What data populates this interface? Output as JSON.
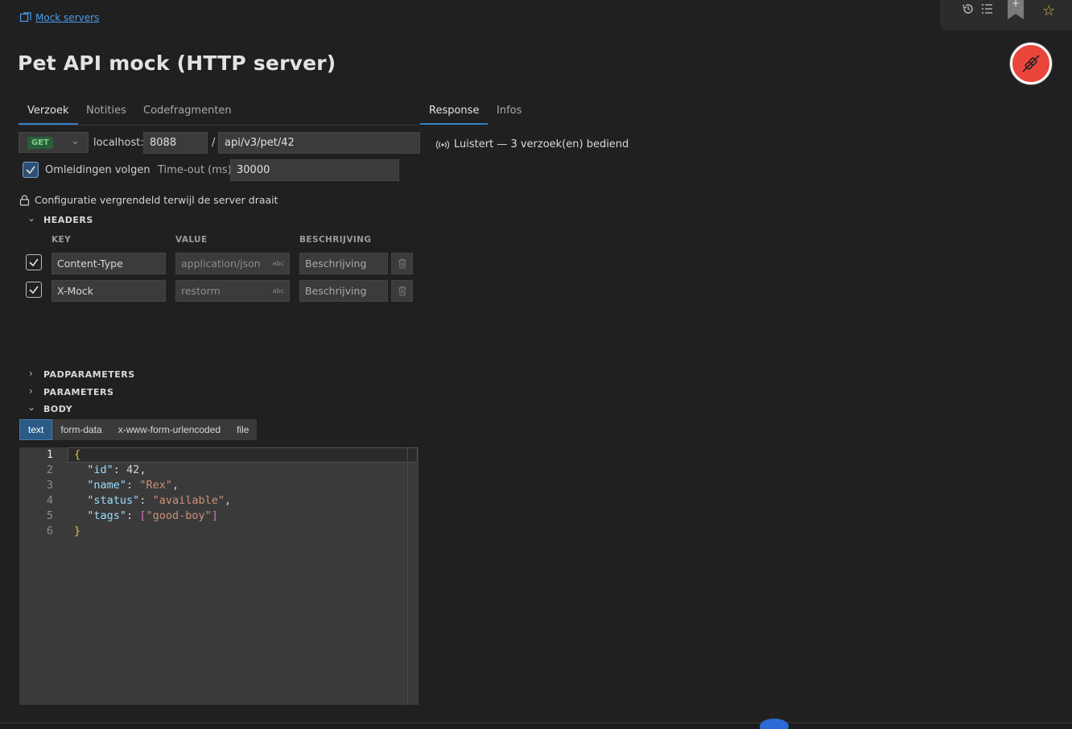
{
  "breadcrumb": {
    "label": "Mock servers"
  },
  "title": "Pet API mock (HTTP server)",
  "toolbar": {
    "icons": [
      "history-icon",
      "list-icon",
      "bookmark-add-icon",
      "star-icon"
    ],
    "star_color": "#e2b74a"
  },
  "status_badge": {
    "color": "#e9453a",
    "icon": "plug-disconnect-icon"
  },
  "left_tabs": [
    {
      "label": "Verzoek",
      "active": true
    },
    {
      "label": "Notities",
      "active": false
    },
    {
      "label": "Codefragmenten",
      "active": false
    }
  ],
  "right_tabs": [
    {
      "label": "Response",
      "active": true
    },
    {
      "label": "Infos",
      "active": false
    }
  ],
  "request": {
    "method": "GET",
    "host_label": "localhost:",
    "port": "8088",
    "separator": "/",
    "path": "api/v3/pet/42"
  },
  "options": {
    "follow_redirects_label": "Omleidingen volgen",
    "follow_redirects": true,
    "timeout_label": "Time-out (ms)",
    "timeout_value": "30000"
  },
  "lock_notice": "Configuratie vergrendeld terwijl de server draait",
  "headers": {
    "section_label": "HEADERS",
    "columns": {
      "key": "KEY",
      "value": "VALUE",
      "description": "BESCHRIJVING"
    },
    "rows": [
      {
        "enabled": true,
        "key": "Content-Type",
        "value": "application/json",
        "value_type": "abc",
        "description": "Beschrijving"
      },
      {
        "enabled": true,
        "key": "X-Mock",
        "value": "restorm",
        "value_type": "abc",
        "description": "Beschrijving"
      }
    ]
  },
  "sections": {
    "path_params": "PADPARAMETERS",
    "params": "PARAMETERS",
    "body": "BODY"
  },
  "body_tabs": [
    {
      "label": "text",
      "active": true
    },
    {
      "label": "form-data",
      "active": false
    },
    {
      "label": "x-www-form-urlencoded",
      "active": false
    },
    {
      "label": "file",
      "active": false
    }
  ],
  "editor": {
    "line_numbers": [
      "1",
      "2",
      "3",
      "4",
      "5",
      "6"
    ],
    "lines": {
      "l1_open": "{",
      "l2_key": "\"id\"",
      "l2_colon": ": ",
      "l2_val": "42",
      "l2_comma": ",",
      "l3_key": "\"name\"",
      "l3_colon": ": ",
      "l3_val": "\"Rex\"",
      "l3_comma": ",",
      "l4_key": "\"status\"",
      "l4_colon": ": ",
      "l4_val": "\"available\"",
      "l4_comma": ",",
      "l5_key": "\"tags\"",
      "l5_colon": ": ",
      "l5_open": "[",
      "l5_val": "\"good-boy\"",
      "l5_close": "]",
      "l6_close": "}"
    }
  },
  "response_status": "Luistert — 3 verzoek(en) bediend"
}
